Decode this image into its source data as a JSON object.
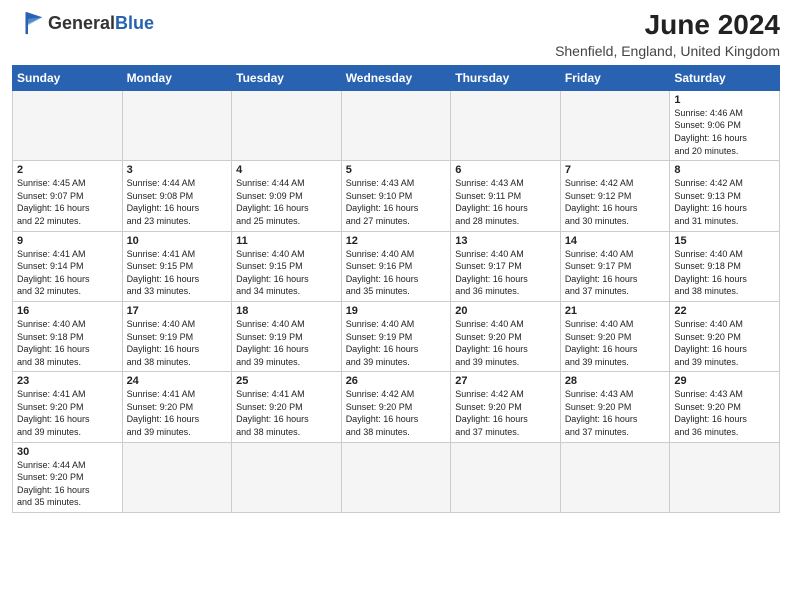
{
  "header": {
    "logo_general": "General",
    "logo_blue": "Blue",
    "month_year": "June 2024",
    "location": "Shenfield, England, United Kingdom"
  },
  "weekdays": [
    "Sunday",
    "Monday",
    "Tuesday",
    "Wednesday",
    "Thursday",
    "Friday",
    "Saturday"
  ],
  "weeks": [
    [
      {
        "day": "",
        "info": ""
      },
      {
        "day": "",
        "info": ""
      },
      {
        "day": "",
        "info": ""
      },
      {
        "day": "",
        "info": ""
      },
      {
        "day": "",
        "info": ""
      },
      {
        "day": "",
        "info": ""
      },
      {
        "day": "1",
        "info": "Sunrise: 4:46 AM\nSunset: 9:06 PM\nDaylight: 16 hours\nand 20 minutes."
      }
    ],
    [
      {
        "day": "2",
        "info": "Sunrise: 4:45 AM\nSunset: 9:07 PM\nDaylight: 16 hours\nand 22 minutes."
      },
      {
        "day": "3",
        "info": "Sunrise: 4:44 AM\nSunset: 9:08 PM\nDaylight: 16 hours\nand 23 minutes."
      },
      {
        "day": "4",
        "info": "Sunrise: 4:44 AM\nSunset: 9:09 PM\nDaylight: 16 hours\nand 25 minutes."
      },
      {
        "day": "5",
        "info": "Sunrise: 4:43 AM\nSunset: 9:10 PM\nDaylight: 16 hours\nand 27 minutes."
      },
      {
        "day": "6",
        "info": "Sunrise: 4:43 AM\nSunset: 9:11 PM\nDaylight: 16 hours\nand 28 minutes."
      },
      {
        "day": "7",
        "info": "Sunrise: 4:42 AM\nSunset: 9:12 PM\nDaylight: 16 hours\nand 30 minutes."
      },
      {
        "day": "8",
        "info": "Sunrise: 4:42 AM\nSunset: 9:13 PM\nDaylight: 16 hours\nand 31 minutes."
      }
    ],
    [
      {
        "day": "9",
        "info": "Sunrise: 4:41 AM\nSunset: 9:14 PM\nDaylight: 16 hours\nand 32 minutes."
      },
      {
        "day": "10",
        "info": "Sunrise: 4:41 AM\nSunset: 9:15 PM\nDaylight: 16 hours\nand 33 minutes."
      },
      {
        "day": "11",
        "info": "Sunrise: 4:40 AM\nSunset: 9:15 PM\nDaylight: 16 hours\nand 34 minutes."
      },
      {
        "day": "12",
        "info": "Sunrise: 4:40 AM\nSunset: 9:16 PM\nDaylight: 16 hours\nand 35 minutes."
      },
      {
        "day": "13",
        "info": "Sunrise: 4:40 AM\nSunset: 9:17 PM\nDaylight: 16 hours\nand 36 minutes."
      },
      {
        "day": "14",
        "info": "Sunrise: 4:40 AM\nSunset: 9:17 PM\nDaylight: 16 hours\nand 37 minutes."
      },
      {
        "day": "15",
        "info": "Sunrise: 4:40 AM\nSunset: 9:18 PM\nDaylight: 16 hours\nand 38 minutes."
      }
    ],
    [
      {
        "day": "16",
        "info": "Sunrise: 4:40 AM\nSunset: 9:18 PM\nDaylight: 16 hours\nand 38 minutes."
      },
      {
        "day": "17",
        "info": "Sunrise: 4:40 AM\nSunset: 9:19 PM\nDaylight: 16 hours\nand 38 minutes."
      },
      {
        "day": "18",
        "info": "Sunrise: 4:40 AM\nSunset: 9:19 PM\nDaylight: 16 hours\nand 39 minutes."
      },
      {
        "day": "19",
        "info": "Sunrise: 4:40 AM\nSunset: 9:19 PM\nDaylight: 16 hours\nand 39 minutes."
      },
      {
        "day": "20",
        "info": "Sunrise: 4:40 AM\nSunset: 9:20 PM\nDaylight: 16 hours\nand 39 minutes."
      },
      {
        "day": "21",
        "info": "Sunrise: 4:40 AM\nSunset: 9:20 PM\nDaylight: 16 hours\nand 39 minutes."
      },
      {
        "day": "22",
        "info": "Sunrise: 4:40 AM\nSunset: 9:20 PM\nDaylight: 16 hours\nand 39 minutes."
      }
    ],
    [
      {
        "day": "23",
        "info": "Sunrise: 4:41 AM\nSunset: 9:20 PM\nDaylight: 16 hours\nand 39 minutes."
      },
      {
        "day": "24",
        "info": "Sunrise: 4:41 AM\nSunset: 9:20 PM\nDaylight: 16 hours\nand 39 minutes."
      },
      {
        "day": "25",
        "info": "Sunrise: 4:41 AM\nSunset: 9:20 PM\nDaylight: 16 hours\nand 38 minutes."
      },
      {
        "day": "26",
        "info": "Sunrise: 4:42 AM\nSunset: 9:20 PM\nDaylight: 16 hours\nand 38 minutes."
      },
      {
        "day": "27",
        "info": "Sunrise: 4:42 AM\nSunset: 9:20 PM\nDaylight: 16 hours\nand 37 minutes."
      },
      {
        "day": "28",
        "info": "Sunrise: 4:43 AM\nSunset: 9:20 PM\nDaylight: 16 hours\nand 37 minutes."
      },
      {
        "day": "29",
        "info": "Sunrise: 4:43 AM\nSunset: 9:20 PM\nDaylight: 16 hours\nand 36 minutes."
      }
    ],
    [
      {
        "day": "30",
        "info": "Sunrise: 4:44 AM\nSunset: 9:20 PM\nDaylight: 16 hours\nand 35 minutes."
      },
      {
        "day": "",
        "info": ""
      },
      {
        "day": "",
        "info": ""
      },
      {
        "day": "",
        "info": ""
      },
      {
        "day": "",
        "info": ""
      },
      {
        "day": "",
        "info": ""
      },
      {
        "day": "",
        "info": ""
      }
    ]
  ]
}
